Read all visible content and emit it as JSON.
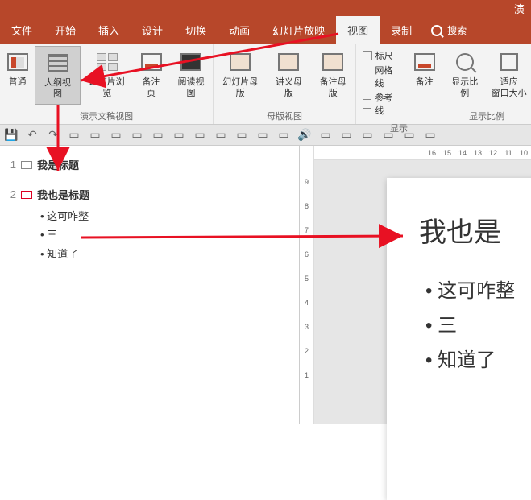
{
  "titlebar": {
    "text": "演"
  },
  "tabs": [
    "文件",
    "开始",
    "插入",
    "设计",
    "切换",
    "动画",
    "幻灯片放映",
    "视图",
    "录制"
  ],
  "active_tab_index": 7,
  "search_label": "搜索",
  "ribbon": {
    "group1": {
      "label": "演示文稿视图",
      "btns": [
        "普通",
        "大纲视图",
        "幻灯片浏览",
        "备注页",
        "阅读视图"
      ]
    },
    "group2": {
      "label": "母版视图",
      "btns": [
        "幻灯片母版",
        "讲义母版",
        "备注母版"
      ]
    },
    "group3": {
      "label": "显示",
      "checks": [
        "标尺",
        "网格线",
        "参考线"
      ],
      "notes": "备注"
    },
    "group4": {
      "label": "显示比例",
      "btns": [
        "显示比例",
        "适应\n窗口大小"
      ]
    }
  },
  "outline": {
    "slides": [
      {
        "num": "1",
        "title": "我是标题",
        "bullets": []
      },
      {
        "num": "2",
        "title": "我也是标题",
        "bullets": [
          "这可咋整",
          "三",
          "知道了"
        ]
      }
    ]
  },
  "slide": {
    "title": "我也是",
    "bullets": [
      "这可咋整",
      "三",
      "知道了"
    ]
  },
  "ruler_h": [
    "16",
    "15",
    "14",
    "13",
    "12",
    "11",
    "10"
  ],
  "ruler_v": [
    "9",
    "8",
    "7",
    "6",
    "5",
    "4",
    "3",
    "2",
    "1"
  ]
}
